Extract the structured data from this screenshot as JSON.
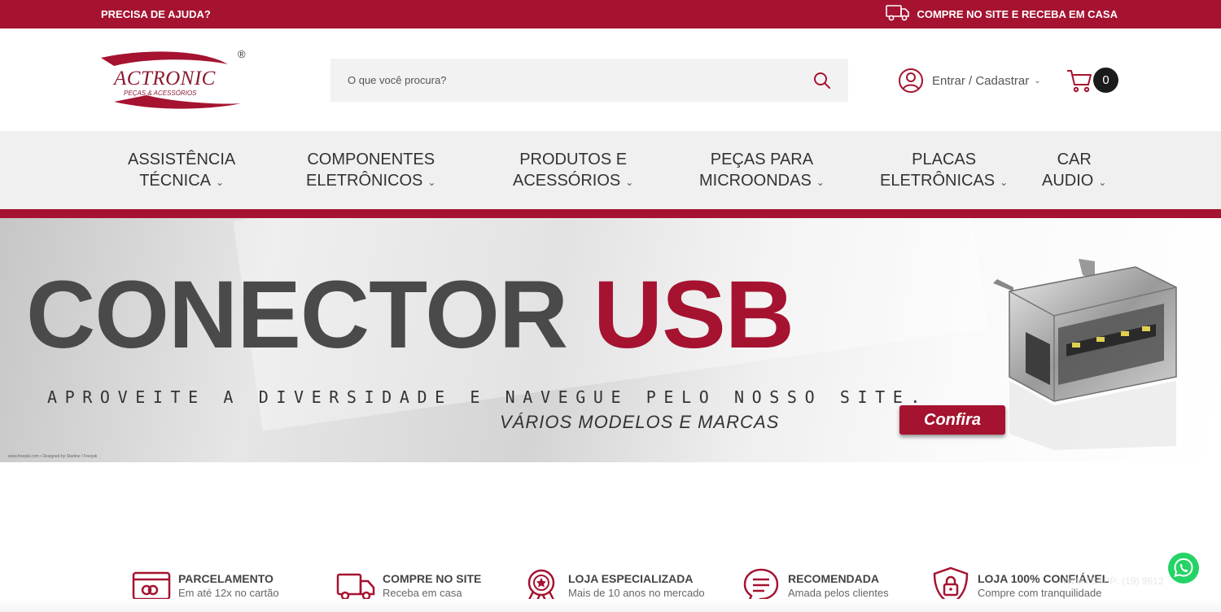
{
  "topbar": {
    "help": "PRECISA DE AJUDA?",
    "shipping": "COMPRE NO SITE E RECEBA EM CASA",
    "shipping_icon": "truck-icon"
  },
  "logo": {
    "brand": "ACTRONIC",
    "tagline": "PEÇAS & ACESSÓRIOS",
    "registered": "®"
  },
  "search": {
    "placeholder": "O que você procura?",
    "icon": "search-icon"
  },
  "account": {
    "label": "Entrar / Cadastrar",
    "icon": "user-icon"
  },
  "cart": {
    "count": "0",
    "icon": "cart-icon"
  },
  "nav": {
    "items": [
      {
        "line1": "ASSISTÊNCIA",
        "line2": "TÉCNICA"
      },
      {
        "line1": "COMPONENTES",
        "line2": "ELETRÔNICOS"
      },
      {
        "line1": "PRODUTOS E",
        "line2": "ACESSÓRIOS"
      },
      {
        "line1": "PEÇAS PARA",
        "line2": "MICROONDAS"
      },
      {
        "line1": "PLACAS",
        "line2": "ELETRÔNICAS"
      },
      {
        "line1": "CAR",
        "line2": "AUDIO"
      }
    ]
  },
  "banner": {
    "title_part1": "CONECTOR",
    "title_part2": "USB",
    "subtitle": "APROVEITE A DIVERSIDADE E NAVEGUE PELO NOSSO SITE.",
    "tagline": "VÁRIOS MODELOS E MARCAS",
    "cta": "Confira",
    "credit": "www.freepik.com • Designed by Starline / Freepik"
  },
  "features": [
    {
      "title": "PARCELAMENTO",
      "desc": "Em até 12x no cartão",
      "icon": "credit-card-icon"
    },
    {
      "title": "COMPRE NO SITE",
      "desc": "Receba em casa",
      "icon": "delivery-truck-icon"
    },
    {
      "title": "LOJA ESPECIALIZADA",
      "desc": "Mais de 10 anos no mercado",
      "icon": "award-star-icon"
    },
    {
      "title": "RECOMENDADA",
      "desc": "Amada pelos clientes",
      "icon": "chat-bubble-icon"
    },
    {
      "title": "LOJA 100% CONFIÁVEL",
      "desc": "Compre com tranquilidade",
      "icon": "shield-lock-icon"
    }
  ],
  "whatsapp": {
    "text": "WHATSAPP: (19) 9612",
    "icon": "whatsapp-icon"
  },
  "colors": {
    "brand_red": "#a51330",
    "dark": "#1b1b1b",
    "nav_bg": "#f0f0f0"
  }
}
